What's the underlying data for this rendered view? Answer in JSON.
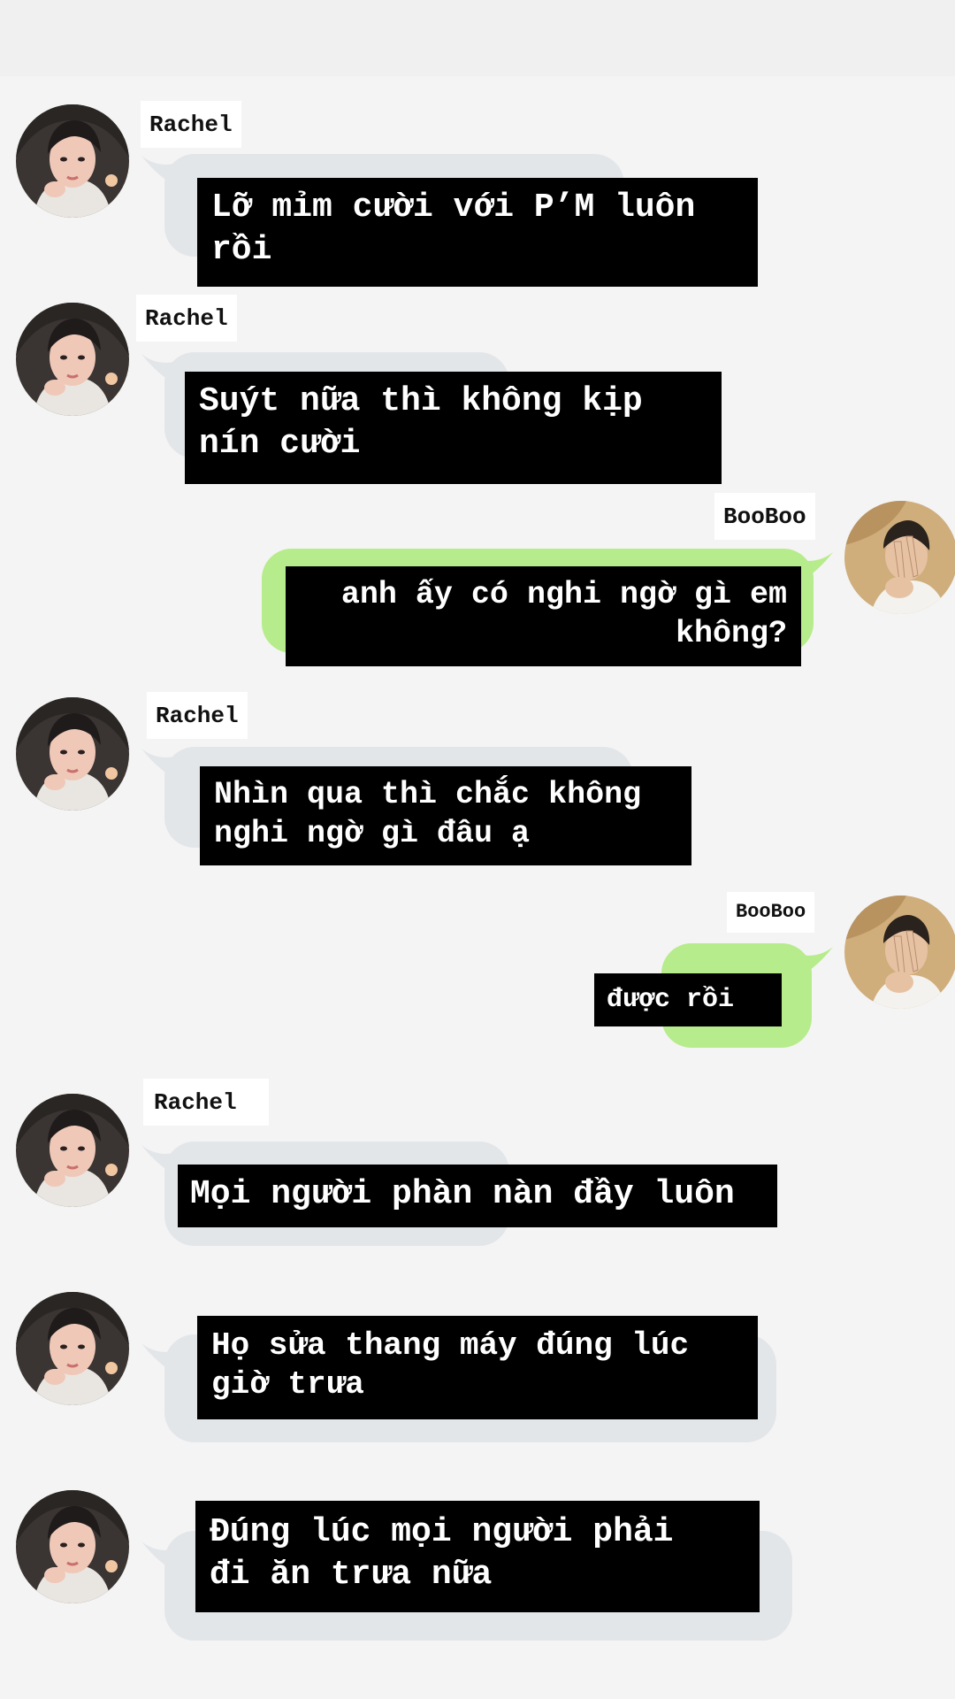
{
  "participants": {
    "rachel": "Rachel",
    "booboo": "BooBoo"
  },
  "avatars": {
    "rachel": "avatar-rachel",
    "booboo": "avatar-booboo"
  },
  "colors": {
    "background": "#f4f4f4",
    "incoming_bubble": "#e3e6e9",
    "outgoing_bubble": "#b6ec8b",
    "caption_box": "#000000",
    "caption_text": "#ffffff"
  },
  "messages": [
    {
      "sender": "Rachel",
      "text": "Lỡ mỉm cười với P’M luôn\nrồi"
    },
    {
      "sender": "Rachel",
      "text": "Suýt nữa thì không kịp\nnín cười"
    },
    {
      "sender": "BooBoo",
      "text": "anh ấy có nghi ngờ gì em\nkhông?"
    },
    {
      "sender": "Rachel",
      "text": "Nhìn qua thì chắc không\nnghi ngờ gì đâu ạ"
    },
    {
      "sender": "BooBoo",
      "text": "được rồi"
    },
    {
      "sender": "Rachel",
      "text": "Mọi người phàn nàn đầy luôn"
    },
    {
      "text": "Họ sửa thang máy đúng lúc\ngiờ trưa"
    },
    {
      "text": "Đúng lúc mọi người phải\nđi ăn trưa nữa"
    }
  ]
}
